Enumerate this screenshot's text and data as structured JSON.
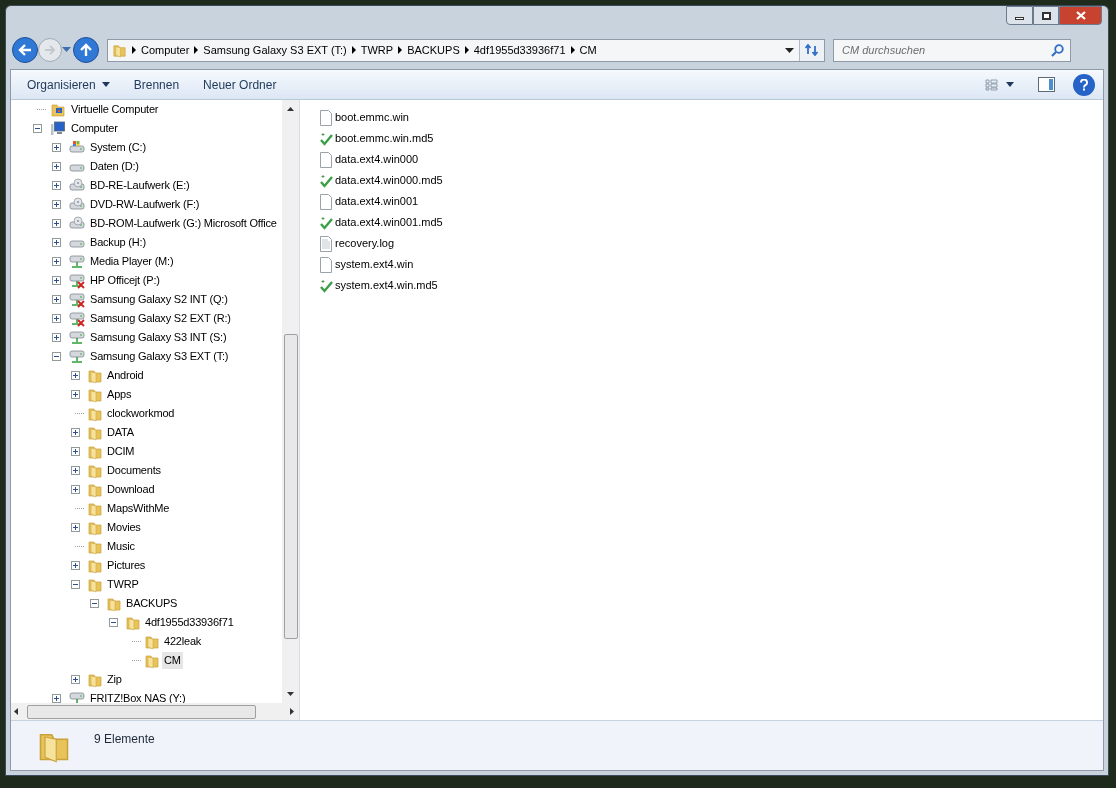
{
  "address_bar": {
    "breadcrumbs": [
      "Computer",
      "Samsung Galaxy S3 EXT (T:)",
      "TWRP",
      "BACKUPS",
      "4df1955d33936f71",
      "CM"
    ]
  },
  "search": {
    "placeholder": "CM durchsuchen"
  },
  "toolbar": {
    "items": [
      {
        "label": "Organisieren",
        "dropdown": true
      },
      {
        "label": "Brennen",
        "dropdown": false
      },
      {
        "label": "Neuer Ordner",
        "dropdown": false
      }
    ]
  },
  "sidebar": {
    "items": [
      {
        "label": "Virtuelle Computer",
        "kind": "vm",
        "selected": false
      },
      {
        "label": "Computer",
        "kind": "computer",
        "expanded": true,
        "selected": false,
        "children": [
          {
            "label": "System (C:)",
            "kind": "system",
            "expanded": false,
            "selected": false
          },
          {
            "label": "Daten (D:)",
            "kind": "drive",
            "expanded": false,
            "selected": false
          },
          {
            "label": "BD-RE-Laufwerk (E:)",
            "kind": "optical",
            "expanded": false,
            "selected": false
          },
          {
            "label": "DVD-RW-Laufwerk (F:)",
            "kind": "optical",
            "expanded": false,
            "selected": false
          },
          {
            "label": "BD-ROM-Laufwerk (G:) Microsoft Office",
            "kind": "optical",
            "expanded": false,
            "selected": false
          },
          {
            "label": "Backup (H:)",
            "kind": "drive",
            "expanded": false,
            "selected": false
          },
          {
            "label": "Media Player (M:)",
            "kind": "network",
            "expanded": false,
            "selected": false
          },
          {
            "label": "HP Officejt (P:)",
            "kind": "network-error",
            "expanded": false,
            "selected": false
          },
          {
            "label": "Samsung Galaxy S2 INT (Q:)",
            "kind": "network-error",
            "expanded": false,
            "selected": false
          },
          {
            "label": "Samsung Galaxy S2 EXT (R:)",
            "kind": "network-error",
            "expanded": false,
            "selected": false
          },
          {
            "label": "Samsung Galaxy S3 INT (S:)",
            "kind": "network",
            "expanded": false,
            "selected": false
          },
          {
            "label": "Samsung Galaxy S3 EXT (T:)",
            "kind": "network",
            "expanded": true,
            "selected": false,
            "children": [
              {
                "label": "Android",
                "kind": "folder",
                "expanded": false,
                "selected": false
              },
              {
                "label": "Apps",
                "kind": "folder",
                "expanded": false,
                "selected": false
              },
              {
                "label": "clockworkmod",
                "kind": "folder",
                "selected": false
              },
              {
                "label": "DATA",
                "kind": "folder",
                "expanded": false,
                "selected": false
              },
              {
                "label": "DCIM",
                "kind": "folder",
                "expanded": false,
                "selected": false
              },
              {
                "label": "Documents",
                "kind": "folder",
                "expanded": false,
                "selected": false
              },
              {
                "label": "Download",
                "kind": "folder",
                "expanded": false,
                "selected": false
              },
              {
                "label": "MapsWithMe",
                "kind": "folder",
                "selected": false
              },
              {
                "label": "Movies",
                "kind": "folder",
                "expanded": false,
                "selected": false
              },
              {
                "label": "Music",
                "kind": "folder",
                "selected": false
              },
              {
                "label": "Pictures",
                "kind": "folder",
                "expanded": false,
                "selected": false
              },
              {
                "label": "TWRP",
                "kind": "folder",
                "expanded": true,
                "selected": false,
                "children": [
                  {
                    "label": "BACKUPS",
                    "kind": "folder",
                    "expanded": true,
                    "selected": false,
                    "children": [
                      {
                        "label": "4df1955d33936f71",
                        "kind": "folder",
                        "expanded": true,
                        "selected": false,
                        "children": [
                          {
                            "label": "422leak",
                            "kind": "folder",
                            "selected": false
                          },
                          {
                            "label": "CM",
                            "kind": "folder",
                            "selected": true
                          }
                        ]
                      }
                    ]
                  }
                ]
              },
              {
                "label": "Zip",
                "kind": "folder",
                "expanded": false,
                "selected": false
              }
            ]
          },
          {
            "label": "FRITZ!Box NAS (Y:)",
            "kind": "network",
            "expanded": false,
            "selected": false
          }
        ]
      }
    ]
  },
  "files": [
    {
      "name": "boot.emmc.win",
      "kind": "file"
    },
    {
      "name": "boot.emmc.win.md5",
      "kind": "checksum"
    },
    {
      "name": "data.ext4.win000",
      "kind": "file"
    },
    {
      "name": "data.ext4.win000.md5",
      "kind": "checksum"
    },
    {
      "name": "data.ext4.win001",
      "kind": "file"
    },
    {
      "name": "data.ext4.win001.md5",
      "kind": "checksum"
    },
    {
      "name": "recovery.log",
      "kind": "text"
    },
    {
      "name": "system.ext4.win",
      "kind": "file"
    },
    {
      "name": "system.ext4.win.md5",
      "kind": "checksum"
    }
  ],
  "status_bar": {
    "text": "9 Elemente"
  }
}
